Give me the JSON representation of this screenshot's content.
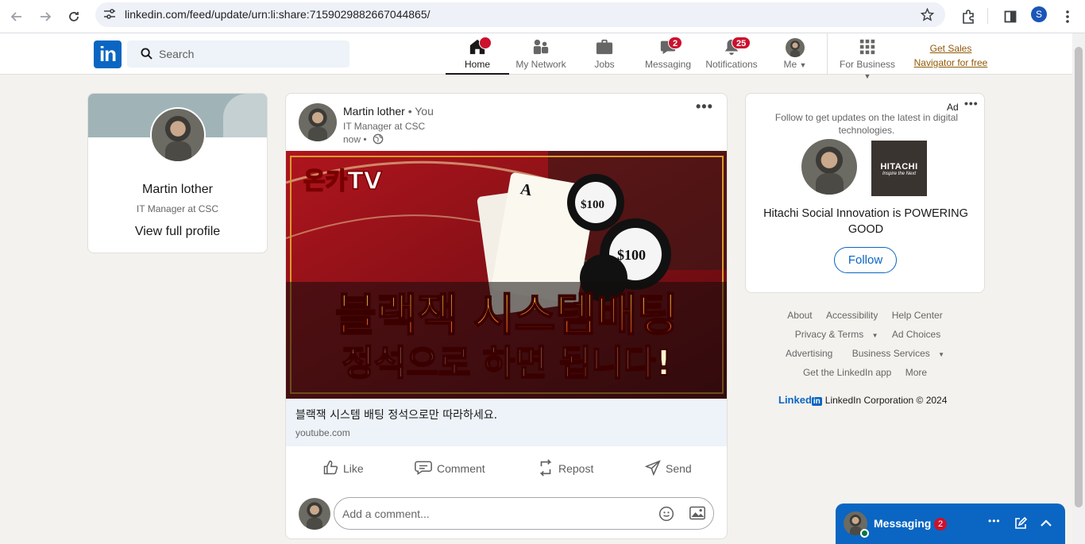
{
  "browser": {
    "url": "linkedin.com/feed/update/urn:li:share:7159029882667044865/",
    "profile_initial": "S"
  },
  "header": {
    "logo": "in",
    "search_placeholder": "Search",
    "nav": [
      {
        "label": "Home",
        "icon": "home-icon",
        "badge": ""
      },
      {
        "label": "My Network",
        "icon": "network-icon",
        "badge": ""
      },
      {
        "label": "Jobs",
        "icon": "briefcase-icon",
        "badge": ""
      },
      {
        "label": "Messaging",
        "icon": "messaging-icon",
        "badge": "2"
      },
      {
        "label": "Notifications",
        "icon": "bell-icon",
        "badge": "25"
      },
      {
        "label": "Me",
        "icon": "avatar",
        "badge": ""
      },
      {
        "label": "For Business",
        "icon": "grid-icon",
        "badge": ""
      }
    ],
    "sales_line1": "Get Sales",
    "sales_line2": "Navigator for free"
  },
  "profile": {
    "name": "Martin lother",
    "title": "IT Manager at CSC",
    "view_link": "View full profile"
  },
  "post": {
    "author": "Martin lother",
    "you": " • You",
    "author_title": "IT Manager at CSC",
    "time": "now •",
    "image": {
      "brand": "온카TV",
      "headline1": "블랙잭 시스템배팅",
      "headline2": "정석으로 하면 됩니다!",
      "chip": "$100"
    },
    "link_title": "블랙잭 시스템 배팅 정석으로만 따라하세요.",
    "link_domain": "youtube.com",
    "actions": {
      "like": "Like",
      "comment": "Comment",
      "repost": "Repost",
      "send": "Send"
    },
    "comment_placeholder": "Add a comment..."
  },
  "ad": {
    "label": "Ad",
    "text": "Follow to get updates on the latest in digital technologies.",
    "company_logo_line1": "HITACHI",
    "company_logo_line2": "Inspire the Next",
    "headline": "Hitachi Social Innovation is POWERING GOOD",
    "follow": "Follow"
  },
  "footer": {
    "row1": [
      "About",
      "Accessibility",
      "Help Center"
    ],
    "row2": [
      "Privacy & Terms",
      "Ad Choices"
    ],
    "row3": [
      "Advertising",
      "Business Services"
    ],
    "row4": [
      "Get the LinkedIn app",
      "More"
    ],
    "corp_logo": "Linked",
    "corp_in": "in",
    "corp_text": "LinkedIn Corporation © 2024"
  },
  "messaging": {
    "label": "Messaging",
    "badge": "2"
  },
  "colors": {
    "brand": "#0a66c2",
    "badge": "#cb112d",
    "background": "#f4f2ee",
    "sales": "#915907"
  }
}
